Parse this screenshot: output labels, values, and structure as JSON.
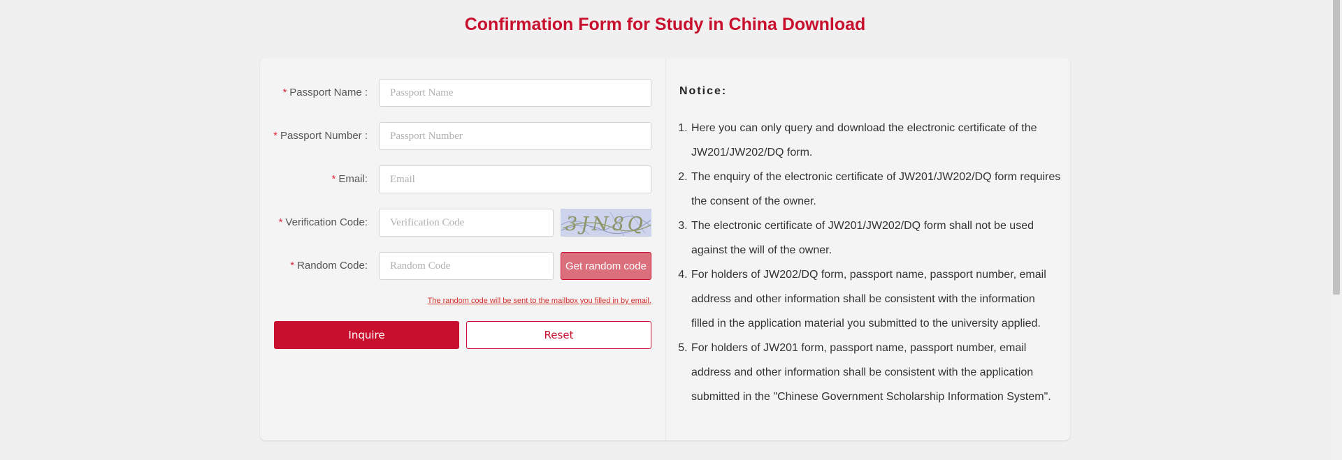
{
  "page_title": "Confirmation Form for Study in China Download",
  "form": {
    "passport_name": {
      "required_mark": "*",
      "label": "Passport Name :",
      "placeholder": "Passport Name",
      "value": ""
    },
    "passport_number": {
      "required_mark": "*",
      "label": "Passport Number :",
      "placeholder": "Passport Number",
      "value": ""
    },
    "email": {
      "required_mark": "*",
      "label": "Email:",
      "placeholder": "Email",
      "value": ""
    },
    "verification_code": {
      "required_mark": "*",
      "label": "Verification Code:",
      "placeholder": "Verification Code",
      "value": "",
      "captcha_text": "3JN8Q"
    },
    "random_code": {
      "required_mark": "*",
      "label": "Random Code:",
      "placeholder": "Random Code",
      "value": "",
      "button_label": "Get random code"
    },
    "hint": "The random code will be sent to the mailbox you filled in by email.",
    "inquire_label": "Inquire",
    "reset_label": "Reset"
  },
  "notice": {
    "title": "Notice:",
    "items": [
      "Here you can only query and download the electronic certificate of the JW201/JW202/DQ form.",
      "The enquiry of the electronic certificate of JW201/JW202/DQ form requires the consent of the owner.",
      "The electronic certificate of JW201/JW202/DQ form shall not be used against the will of the owner.",
      "For holders of JW202/DQ form, passport name, passport number, email address and other information shall be consistent with the information filled in the application material you submitted to the university applied.",
      "For holders of JW201 form, passport name, passport number, email address and other information shall be consistent with the application submitted in the \"Chinese Government Scholarship Information System\"."
    ]
  },
  "colors": {
    "accent": "#c8102e",
    "required": "#e0273a",
    "background": "#f0f0f0",
    "card": "#f4f4f4"
  }
}
